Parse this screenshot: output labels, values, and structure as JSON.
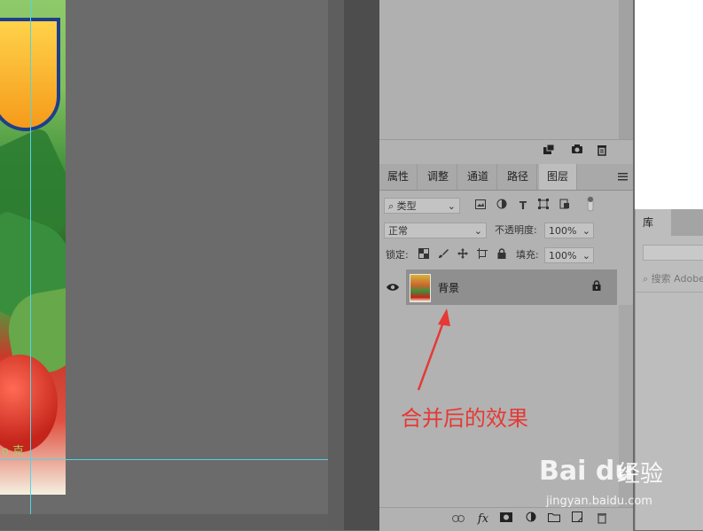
{
  "canvas": {
    "doc_text": "ο 克"
  },
  "upper_toolbar": {
    "icons": [
      "new-snapshot-icon",
      "camera-icon",
      "trash-icon"
    ]
  },
  "tabs": [
    {
      "label": "属性"
    },
    {
      "label": "调整"
    },
    {
      "label": "通道"
    },
    {
      "label": "路径"
    },
    {
      "label": "图层"
    }
  ],
  "filter": {
    "kind_value": "类型",
    "icons": [
      "image-filter-icon",
      "adjustment-filter-icon",
      "type-filter-icon",
      "shape-filter-icon",
      "smartobject-filter-icon"
    ]
  },
  "blend": {
    "mode_value": "正常",
    "opacity_label": "不透明度:",
    "opacity_value": "100%"
  },
  "lock": {
    "label": "锁定:",
    "fill_label": "填充:",
    "fill_value": "100%"
  },
  "layer": {
    "name": "背景"
  },
  "bottom_toolbar": {
    "icons": [
      "link-icon",
      "fx-icon",
      "mask-icon",
      "adjustment-icon",
      "folder-icon",
      "new-layer-icon",
      "trash-icon"
    ],
    "fx_label": "fx"
  },
  "annotation": {
    "text": "合并后的效果",
    "color": "#e53935"
  },
  "library": {
    "tab_label": "库",
    "search_placeholder": "搜索 Adobe"
  },
  "watermark": {
    "logo": "Bai du",
    "brand": "经验",
    "url": "jingyan.baidu.com"
  }
}
